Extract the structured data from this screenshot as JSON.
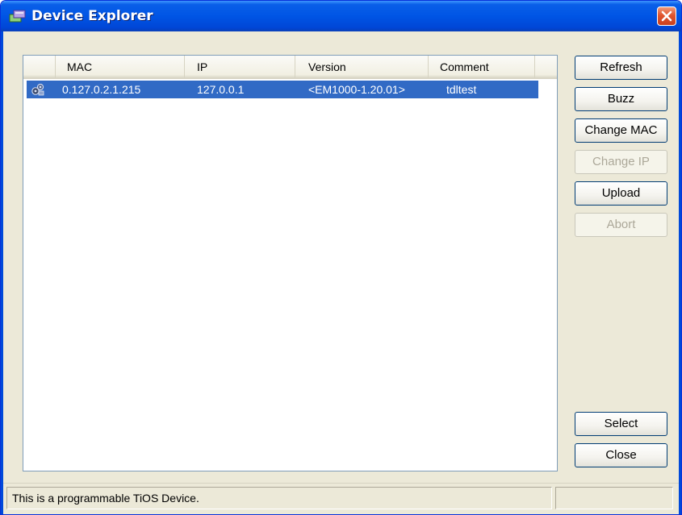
{
  "window": {
    "title": "Device Explorer"
  },
  "list": {
    "columns": [
      "MAC",
      "IP",
      "Version",
      "Comment"
    ],
    "rows": [
      {
        "mac": "0.127.0.2.1.215",
        "ip": "127.0.0.1",
        "version": "<EM1000-1.20.01>",
        "comment": "tdltest",
        "selected": true
      }
    ]
  },
  "buttons": {
    "refresh": "Refresh",
    "buzz": "Buzz",
    "change_mac": "Change MAC",
    "change_ip": "Change IP",
    "upload": "Upload",
    "abort": "Abort",
    "select": "Select",
    "close": "Close"
  },
  "status": {
    "text": "This is a programmable TiOS Device."
  },
  "icons": {
    "title": "device-explorer-icon",
    "row": "device-icon",
    "close": "close-icon"
  },
  "colors": {
    "titlebar": "#0055e5",
    "selection": "#316ac5",
    "close_button": "#e0552f",
    "window_bg": "#ece9d8"
  }
}
